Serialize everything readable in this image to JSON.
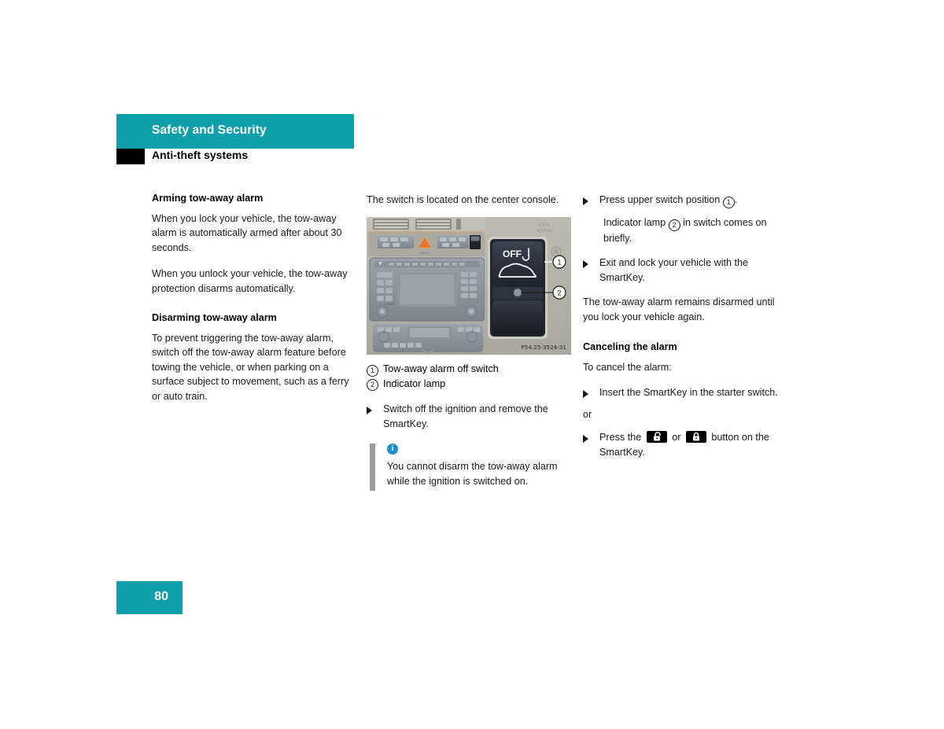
{
  "header": {
    "section_title": "Safety and Security",
    "subsection_title": "Anti-theft systems"
  },
  "left_column": {
    "heading_1": "Arming tow-away alarm",
    "para_1": "When you lock your vehicle, the tow-away alarm is automatically armed after about 30 seconds.",
    "para_2": "When you unlock your vehicle, the tow-away protection disarms automatically.",
    "heading_2": "Disarming tow-away alarm",
    "para_3": "To prevent triggering the tow-away alarm, switch off the tow-away alarm feature before towing the vehicle, or when parking on a surface subject to movement, such as a ferry or auto train."
  },
  "middle_column": {
    "intro": "The switch is located on the center console.",
    "figure": {
      "caption_id": "P54.25-3524-31",
      "switch_label": "OFF",
      "callout_1": "1",
      "callout_2": "2"
    },
    "legend": [
      {
        "num": "1",
        "label": "Tow-away alarm off switch"
      },
      {
        "num": "2",
        "label": "Indicator lamp"
      }
    ],
    "bullet_1": "Switch off the ignition and remove the SmartKey.",
    "note": {
      "icon": "info-icon",
      "text": "You cannot disarm the tow-away alarm while the ignition is switched on."
    }
  },
  "right_column": {
    "bullet_1_pre": "Press upper switch position ",
    "bullet_1_num": "1",
    "bullet_1_post": ".",
    "subnote_1_pre": "Indicator lamp ",
    "subnote_1_num": "2",
    "subnote_1_post": " in switch comes on briefly.",
    "bullet_2": "Exit and lock your vehicle with the SmartKey.",
    "para_1": "The tow-away alarm remains disarmed until you lock your vehicle again.",
    "heading_1": "Canceling the alarm",
    "para_2": "To cancel the alarm:",
    "bullet_3": "Insert the SmartKey in the starter switch.",
    "or_label": "or",
    "bullet_4_pre": "Press the ",
    "bullet_4_mid": " or ",
    "bullet_4_post": " button on the SmartKey.",
    "unlock_icon": "unlock-padlock-icon",
    "lock_icon": "lock-padlock-icon"
  },
  "footer": {
    "page_number": "80"
  },
  "colors": {
    "accent_teal": "#0e9fab",
    "info_blue": "#1a8fd1",
    "note_bar_gray": "#9b9b9b",
    "text_black": "#1a1a1a"
  }
}
